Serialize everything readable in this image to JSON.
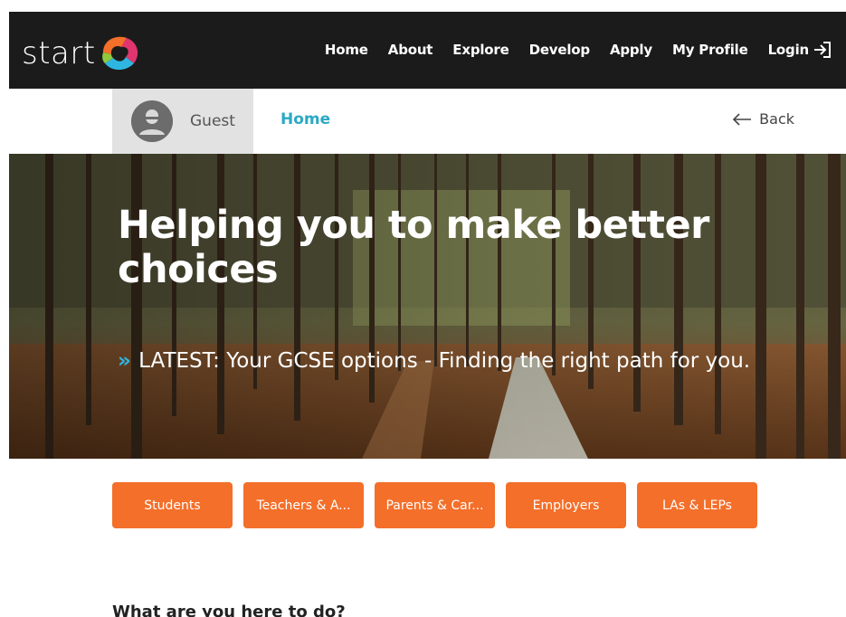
{
  "header": {
    "logo_text": "start",
    "nav": [
      {
        "label": "Home"
      },
      {
        "label": "About"
      },
      {
        "label": "Explore"
      },
      {
        "label": "Develop"
      },
      {
        "label": "Apply"
      },
      {
        "label": "My Profile"
      },
      {
        "label": "Login"
      }
    ],
    "logo_icon": "start-swirl-icon",
    "login_icon": "sign-in-icon"
  },
  "subbar": {
    "user_label": "Guest",
    "avatar_icon": "user-avatar-icon",
    "breadcrumb_home": "Home",
    "back_label": "Back",
    "back_icon": "arrow-left-icon"
  },
  "hero": {
    "title": "Helping you to make better choices",
    "latest_prefix": "»",
    "latest_text": "LATEST: Your GCSE options - Finding the right path for you."
  },
  "audience_buttons": [
    {
      "label": "Students"
    },
    {
      "label": "Teachers & A..."
    },
    {
      "label": "Parents & Car..."
    },
    {
      "label": "Employers"
    },
    {
      "label": "LAs & LEPs"
    }
  ],
  "section": {
    "heading": "What are you here to do?"
  },
  "colors": {
    "nav_bg": "#1b1b1b",
    "accent_orange": "#f36f2a",
    "link_teal": "#2ba9c5",
    "guest_bg": "#e2e2e2"
  }
}
